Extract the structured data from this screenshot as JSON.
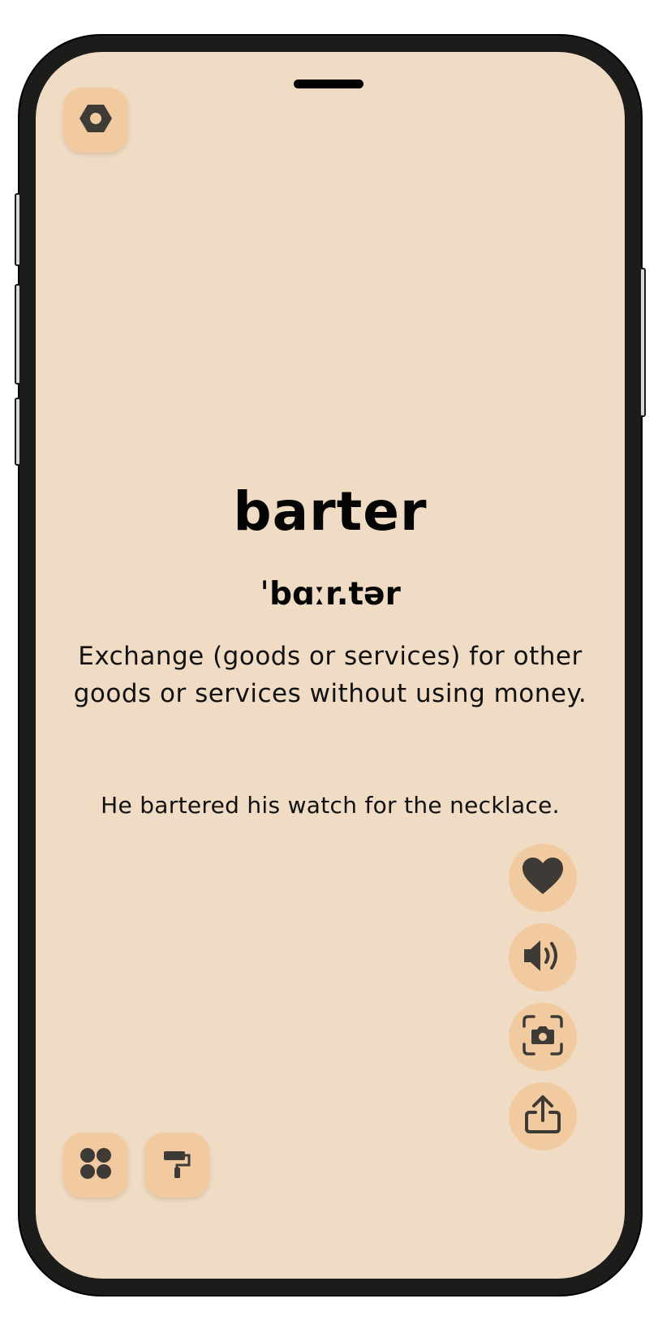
{
  "word": {
    "term": "barter",
    "phonetic": "ˈbɑːr.tər",
    "definition": "Exchange (goods or services) for other goods or services without using money.",
    "example": "He bartered his watch for the necklace."
  },
  "icons": {
    "settings": "hexagon-nut-icon",
    "favorite": "heart-icon",
    "sound": "speaker-icon",
    "screenshot": "camera-icon",
    "share": "share-icon",
    "categories": "grid-icon",
    "themes": "paint-roller-icon"
  },
  "colors": {
    "background": "#f0dcc4",
    "button": "#f2caa0",
    "icon": "#3e3a36",
    "text": "#050505"
  }
}
